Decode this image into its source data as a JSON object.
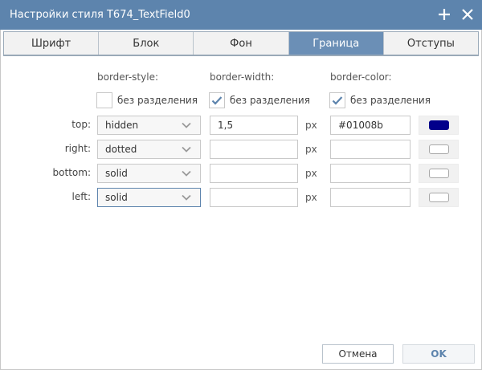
{
  "window": {
    "title": "Настройки стиля T674_TextField0"
  },
  "tabs": [
    {
      "label": "Шрифт",
      "active": false
    },
    {
      "label": "Блок",
      "active": false
    },
    {
      "label": "Фон",
      "active": false
    },
    {
      "label": "Граница",
      "active": true
    },
    {
      "label": "Отступы",
      "active": false
    }
  ],
  "columns": {
    "style_header": "border-style:",
    "width_header": "border-width:",
    "color_header": "border-color:"
  },
  "same_for_all": {
    "style": {
      "label": "без разделения",
      "checked": false
    },
    "width": {
      "label": "без разделения",
      "checked": true
    },
    "color": {
      "label": "без разделения",
      "checked": true
    }
  },
  "rows": [
    {
      "label": "top:",
      "style": "hidden",
      "width": "1,5",
      "unit": "px",
      "color": "#01008b",
      "swatch": "#01008b"
    },
    {
      "label": "right:",
      "style": "dotted",
      "width": "",
      "unit": "px",
      "color": "",
      "swatch": "#ffffff"
    },
    {
      "label": "bottom:",
      "style": "solid",
      "width": "",
      "unit": "px",
      "color": "",
      "swatch": "#ffffff"
    },
    {
      "label": "left:",
      "style": "solid",
      "width": "",
      "unit": "px",
      "color": "",
      "swatch": "#ffffff"
    }
  ],
  "buttons": {
    "cancel": "Отмена",
    "ok": "OK"
  },
  "icons": {
    "title_actions": [
      "plus-icon",
      "close-icon"
    ],
    "dropdown": "chevron-down-icon",
    "checkbox": "checkmark-icon"
  },
  "colors": {
    "titlebar": "#5d84ad",
    "active_tab": "#6b8fb6",
    "ok_text": "#5d84ad"
  }
}
